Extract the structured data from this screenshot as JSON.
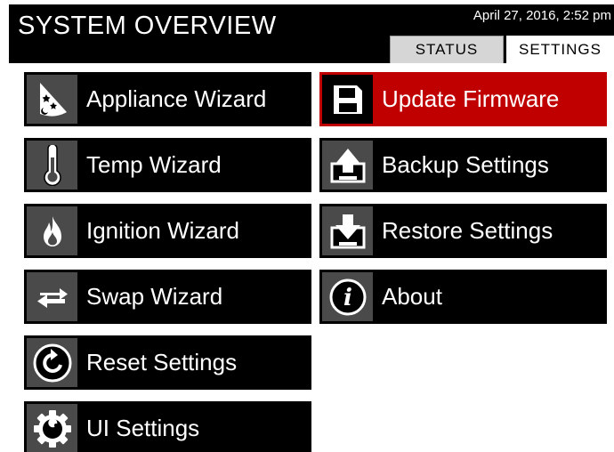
{
  "header": {
    "title": "SYSTEM OVERVIEW",
    "datetime": "April 27, 2016, 2:52 pm",
    "tabs": [
      {
        "label": "STATUS",
        "active": false
      },
      {
        "label": "SETTINGS",
        "active": true
      }
    ]
  },
  "left_menu": [
    {
      "label": "Appliance Wizard",
      "icon": "wizard-hat-icon"
    },
    {
      "label": "Temp Wizard",
      "icon": "thermometer-icon"
    },
    {
      "label": "Ignition Wizard",
      "icon": "flame-icon"
    },
    {
      "label": "Swap Wizard",
      "icon": "swap-arrows-icon"
    },
    {
      "label": "Reset Settings",
      "icon": "reset-icon"
    },
    {
      "label": "UI Settings",
      "icon": "gear-wrench-icon"
    }
  ],
  "right_menu": [
    {
      "label": "Update Firmware",
      "icon": "floppy-disk-icon",
      "highlighted": true
    },
    {
      "label": "Backup Settings",
      "icon": "backup-upload-icon"
    },
    {
      "label": "Restore Settings",
      "icon": "restore-download-icon"
    },
    {
      "label": "About",
      "icon": "info-icon"
    }
  ],
  "colors": {
    "background": "#ffffff",
    "button": "#000000",
    "icon_box": "#4a4a4a",
    "highlight": "#c00000",
    "active_tab": "#ffffff",
    "inactive_tab": "#d6d6d6"
  }
}
